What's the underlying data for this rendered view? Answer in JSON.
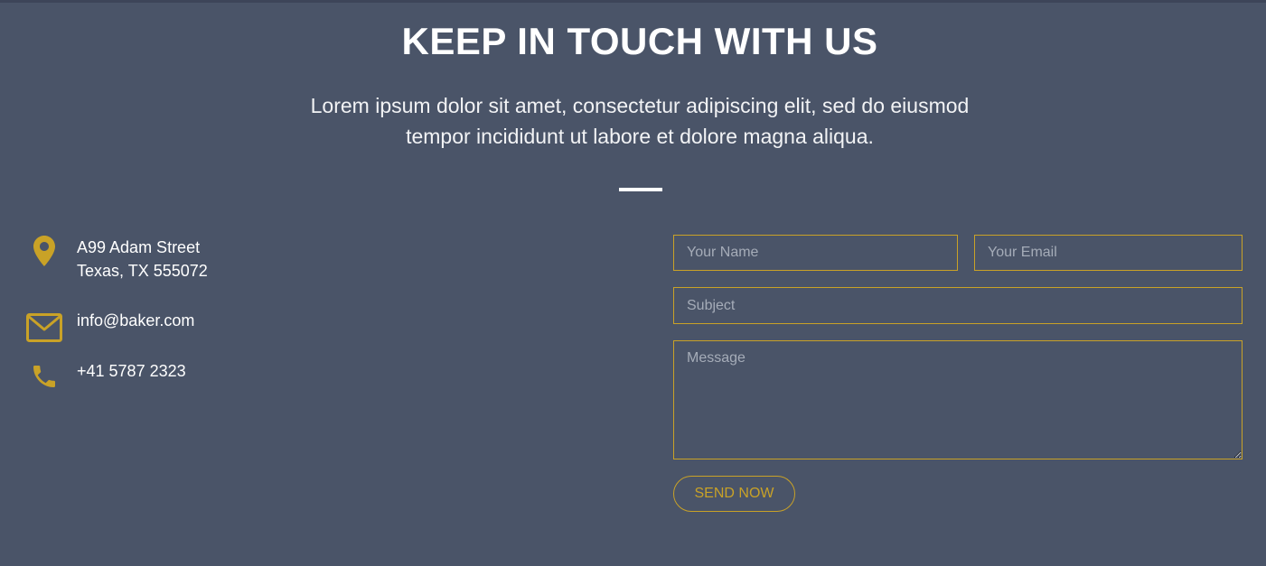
{
  "section": {
    "title": "KEEP IN TOUCH WITH US",
    "subtitle_line1": "Lorem ipsum dolor sit amet, consectetur adipiscing elit, sed do eiusmod",
    "subtitle_line2": "tempor incididunt ut labore et dolore magna aliqua."
  },
  "contact": {
    "address_line1": "A99 Adam Street",
    "address_line2": "Texas, TX 555072",
    "email": "info@baker.com",
    "phone": "+41 5787 2323",
    "icons": [
      "map-pin-icon",
      "envelope-icon",
      "phone-icon"
    ]
  },
  "form": {
    "name_placeholder": "Your Name",
    "email_placeholder": "Your Email",
    "subject_placeholder": "Subject",
    "message_placeholder": "Message",
    "submit_label": "SEND NOW"
  },
  "colors": {
    "background": "#4a5468",
    "accent": "#c9a227",
    "text": "#ffffff"
  }
}
